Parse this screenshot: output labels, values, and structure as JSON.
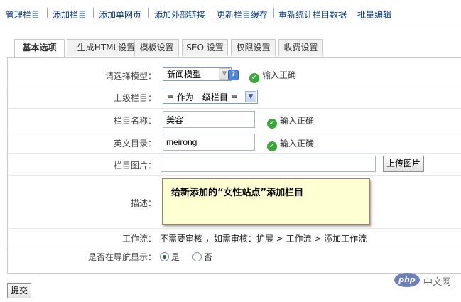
{
  "top_nav": [
    "管理栏目",
    "添加栏目",
    "添加单网页",
    "添加外部链接",
    "更新栏目缓存",
    "重新统计栏目数据",
    "批量编辑"
  ],
  "tabs": [
    "基本选项",
    "生成HTML设置",
    "模板设置",
    "SEO 设置",
    "权限设置",
    "收费设置"
  ],
  "form": {
    "model": {
      "label": "请选择模型：",
      "value": "新闻模型",
      "status": "输入正确"
    },
    "parent": {
      "label": "上级栏目：",
      "value": "≡ 作为一级栏目 ≡"
    },
    "name": {
      "label": "栏目名称：",
      "value": "美容",
      "status": "输入正确"
    },
    "english_dir": {
      "label": "英文目录：",
      "value": "meirong",
      "status": "输入正确"
    },
    "image": {
      "label": "栏目图片：",
      "value": "",
      "upload_label": "上传图片"
    },
    "description": {
      "label": "描述：",
      "value": "给新添加的“女性站点”添加栏目"
    },
    "workflow": {
      "label": "工作流：",
      "text": "不需要审核 ，如需审核：扩展 > 工作流 > 添加工作流"
    },
    "nav_show": {
      "label": "是否在导航显示：",
      "yes": "是",
      "no": "否",
      "selected": "yes"
    }
  },
  "submit_label": "提交",
  "watermark": {
    "logo": "php",
    "text": "中文网"
  }
}
